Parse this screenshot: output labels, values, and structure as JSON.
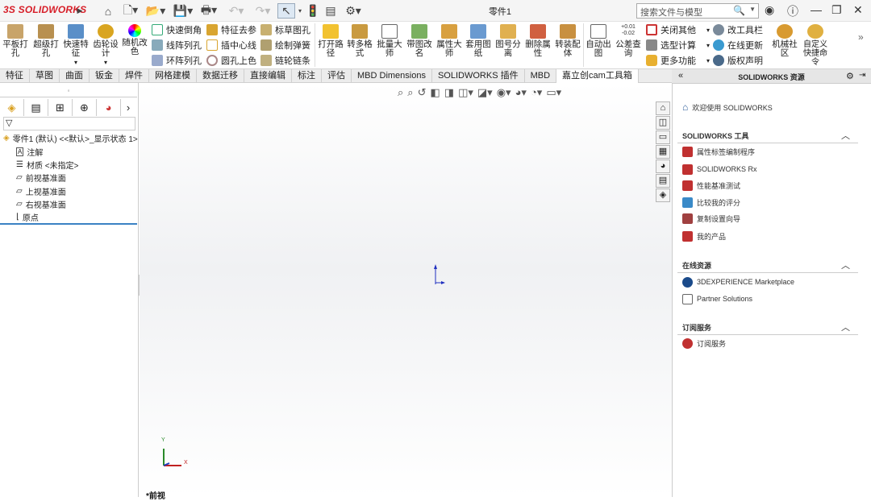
{
  "app": {
    "brand_ds": "3S",
    "brand": "SOLIDWORKS",
    "title": "零件1"
  },
  "search": {
    "placeholder": "搜索文件与模型"
  },
  "ribbon": {
    "big": [
      "平板打孔",
      "超级打孔",
      "快速特征",
      "齿轮设计",
      "随机改色",
      "打开路径",
      "转多格式",
      "批量大师",
      "带图改名",
      "属性大师",
      "套用图纸",
      "图号分离",
      "删除属性",
      "转装配体",
      "自动出图",
      "公差查询",
      "机械社区",
      "自定义快捷命令"
    ],
    "col1": [
      "快速倒角",
      "线阵列孔",
      "环阵列孔"
    ],
    "col2": [
      "特征去参",
      "插中心线",
      "圆孔上色"
    ],
    "col3": [
      "标草图孔",
      "绘制弹簧",
      "链轮链条"
    ],
    "col4": [
      "关闭其他",
      "选型计算",
      "更多功能"
    ],
    "col5": [
      "改工具栏",
      "在线更新",
      "版权声明"
    ]
  },
  "tabs": [
    "特征",
    "草图",
    "曲面",
    "钣金",
    "焊件",
    "网格建模",
    "数据迁移",
    "直接编辑",
    "标注",
    "评估",
    "MBD Dimensions",
    "SOLIDWORKS 插件",
    "MBD",
    "嘉立创cam工具箱"
  ],
  "tree": {
    "root": "零件1 (默认) <<默认>_显示状态 1>",
    "items": [
      "注解",
      "材质 <未指定>",
      "前视基准面",
      "上视基准面",
      "右视基准面",
      "原点"
    ]
  },
  "viewport": {
    "view_label": "*前视",
    "triad_x": "X",
    "triad_y": "Y"
  },
  "taskpane": {
    "header": "SOLIDWORKS 资源",
    "welcome": "欢迎使用 SOLIDWORKS",
    "sections": [
      {
        "title": "SOLIDWORKS 工具",
        "items": [
          "属性标签编制程序",
          "SOLIDWORKS Rx",
          "性能基准测试",
          "比较我的评分",
          "复制设置向导",
          "我的产品"
        ]
      },
      {
        "title": "在线资源",
        "items": [
          "3DEXPERIENCE Marketplace",
          "Partner Solutions"
        ]
      },
      {
        "title": "订阅服务",
        "items": [
          "订阅服务"
        ]
      }
    ]
  }
}
